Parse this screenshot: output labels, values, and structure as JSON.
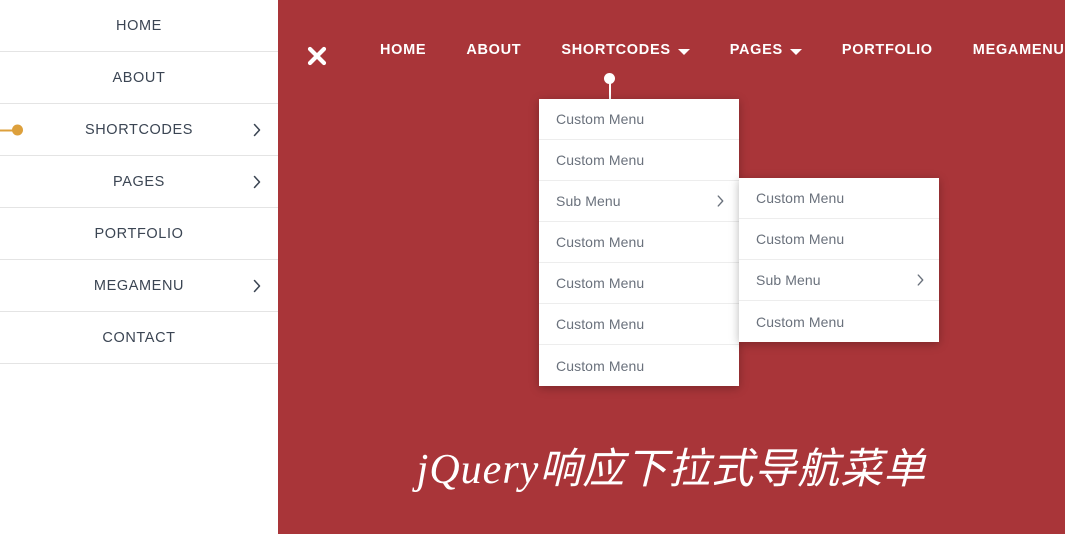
{
  "colors": {
    "panel_red": "#a93539",
    "accent_orange": "#dda03c",
    "sidebar_text": "#3b4553",
    "dropdown_text": "#6a717c",
    "nav_text": "#ffffff"
  },
  "sidebar": {
    "items": [
      {
        "label": "HOME",
        "has_chevron": false,
        "active": false
      },
      {
        "label": "ABOUT",
        "has_chevron": false,
        "active": false
      },
      {
        "label": "SHORTCODES",
        "has_chevron": true,
        "active": true
      },
      {
        "label": "PAGES",
        "has_chevron": true,
        "active": false
      },
      {
        "label": "PORTFOLIO",
        "has_chevron": false,
        "active": false
      },
      {
        "label": "MEGAMENU",
        "has_chevron": true,
        "active": false
      },
      {
        "label": "CONTACT",
        "has_chevron": false,
        "active": false
      }
    ]
  },
  "navbar": {
    "close_icon": "close-icon",
    "items": [
      {
        "label": "HOME",
        "has_caret": false,
        "active": false
      },
      {
        "label": "ABOUT",
        "has_caret": false,
        "active": false
      },
      {
        "label": "SHORTCODES",
        "has_caret": true,
        "active": true
      },
      {
        "label": "PAGES",
        "has_caret": true,
        "active": false
      },
      {
        "label": "PORTFOLIO",
        "has_caret": false,
        "active": false
      },
      {
        "label": "MEGAMENU",
        "has_caret": true,
        "active": false
      }
    ]
  },
  "dropdown_level1": {
    "items": [
      {
        "label": "Custom Menu",
        "has_chevron": false
      },
      {
        "label": "Custom Menu",
        "has_chevron": false
      },
      {
        "label": "Sub Menu",
        "has_chevron": true
      },
      {
        "label": "Custom Menu",
        "has_chevron": false
      },
      {
        "label": "Custom Menu",
        "has_chevron": false
      },
      {
        "label": "Custom Menu",
        "has_chevron": false
      },
      {
        "label": "Custom Menu",
        "has_chevron": false
      }
    ]
  },
  "dropdown_level2": {
    "items": [
      {
        "label": "Custom Menu",
        "has_chevron": false
      },
      {
        "label": "Custom Menu",
        "has_chevron": false
      },
      {
        "label": "Sub Menu",
        "has_chevron": true
      },
      {
        "label": "Custom Menu",
        "has_chevron": false
      }
    ]
  },
  "hero": {
    "title": "jQuery响应下拉式导航菜单"
  }
}
